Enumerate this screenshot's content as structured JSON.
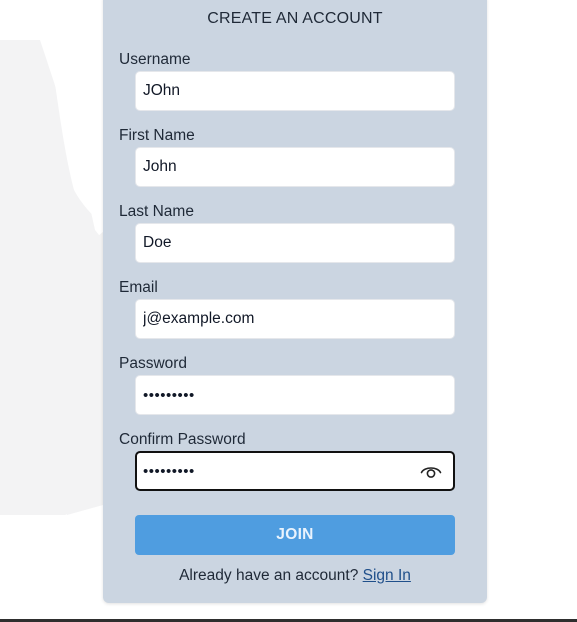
{
  "form": {
    "title": "CREATE AN ACCOUNT",
    "fields": {
      "username": {
        "label": "Username",
        "value": "JOhn"
      },
      "first_name": {
        "label": "First Name",
        "value": "John"
      },
      "last_name": {
        "label": "Last Name",
        "value": "Doe"
      },
      "email": {
        "label": "Email",
        "value": "j@example.com"
      },
      "password": {
        "label": "Password",
        "value": "•••••••••"
      },
      "confirm_password": {
        "label": "Confirm Password",
        "value": "•••••••••"
      }
    },
    "join_label": "JOIN",
    "signin_prompt": "Already have an account?",
    "signin_link": "Sign In"
  },
  "icons": {
    "reveal_password": "eye-icon"
  },
  "colors": {
    "card_background": "#cbd5e1",
    "join_button": "#4f9de0",
    "link": "#1f4f8a"
  }
}
